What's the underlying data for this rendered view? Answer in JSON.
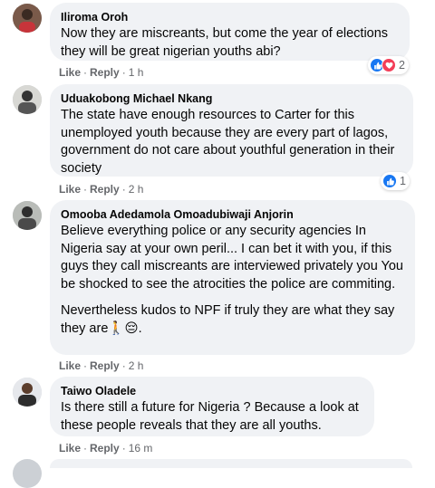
{
  "comments": [
    {
      "author": "Iliroma Oroh",
      "paragraphs": [
        "Now they are miscreants, but come the year of elections they will be great nigerian youths abi?"
      ],
      "actions": {
        "like": "Like",
        "reply": "Reply",
        "time": "1 h"
      },
      "reactions": {
        "types": [
          "like-icon",
          "love-icon"
        ],
        "count": "2"
      }
    },
    {
      "author": "Uduakobong Michael Nkang",
      "paragraphs": [
        "The state have enough resources to Carter for this unemployed youth because they are every part of lagos, government do not care about youthful generation in their society"
      ],
      "actions": {
        "like": "Like",
        "reply": "Reply",
        "time": "2 h"
      },
      "reactions": {
        "types": [
          "like-icon"
        ],
        "count": "1"
      }
    },
    {
      "author": "Omooba Adedamola Omoadubiwaji Anjorin",
      "paragraphs": [
        "Believe everything police or any security agencies In Nigeria say at your own peril... I can bet it with you, if this guys they call miscreants are interviewed privately you You be shocked to see the atrocities the police are commiting.",
        "Nevertheless kudos to NPF if truly they are what they say they are🚶😔."
      ],
      "actions": {
        "like": "Like",
        "reply": "Reply",
        "time": "2 h"
      }
    },
    {
      "author": "Taiwo Oladele",
      "paragraphs": [
        "Is there still a future for Nigeria ? Because a look at these people reveals that they are all youths."
      ],
      "actions": {
        "like": "Like",
        "reply": "Reply",
        "time": "16 m"
      }
    }
  ],
  "separator": "·",
  "colors": {
    "bubble": "#f0f2f5",
    "meta": "#65676b",
    "like": "#1877f2",
    "love": "#f33e58"
  }
}
